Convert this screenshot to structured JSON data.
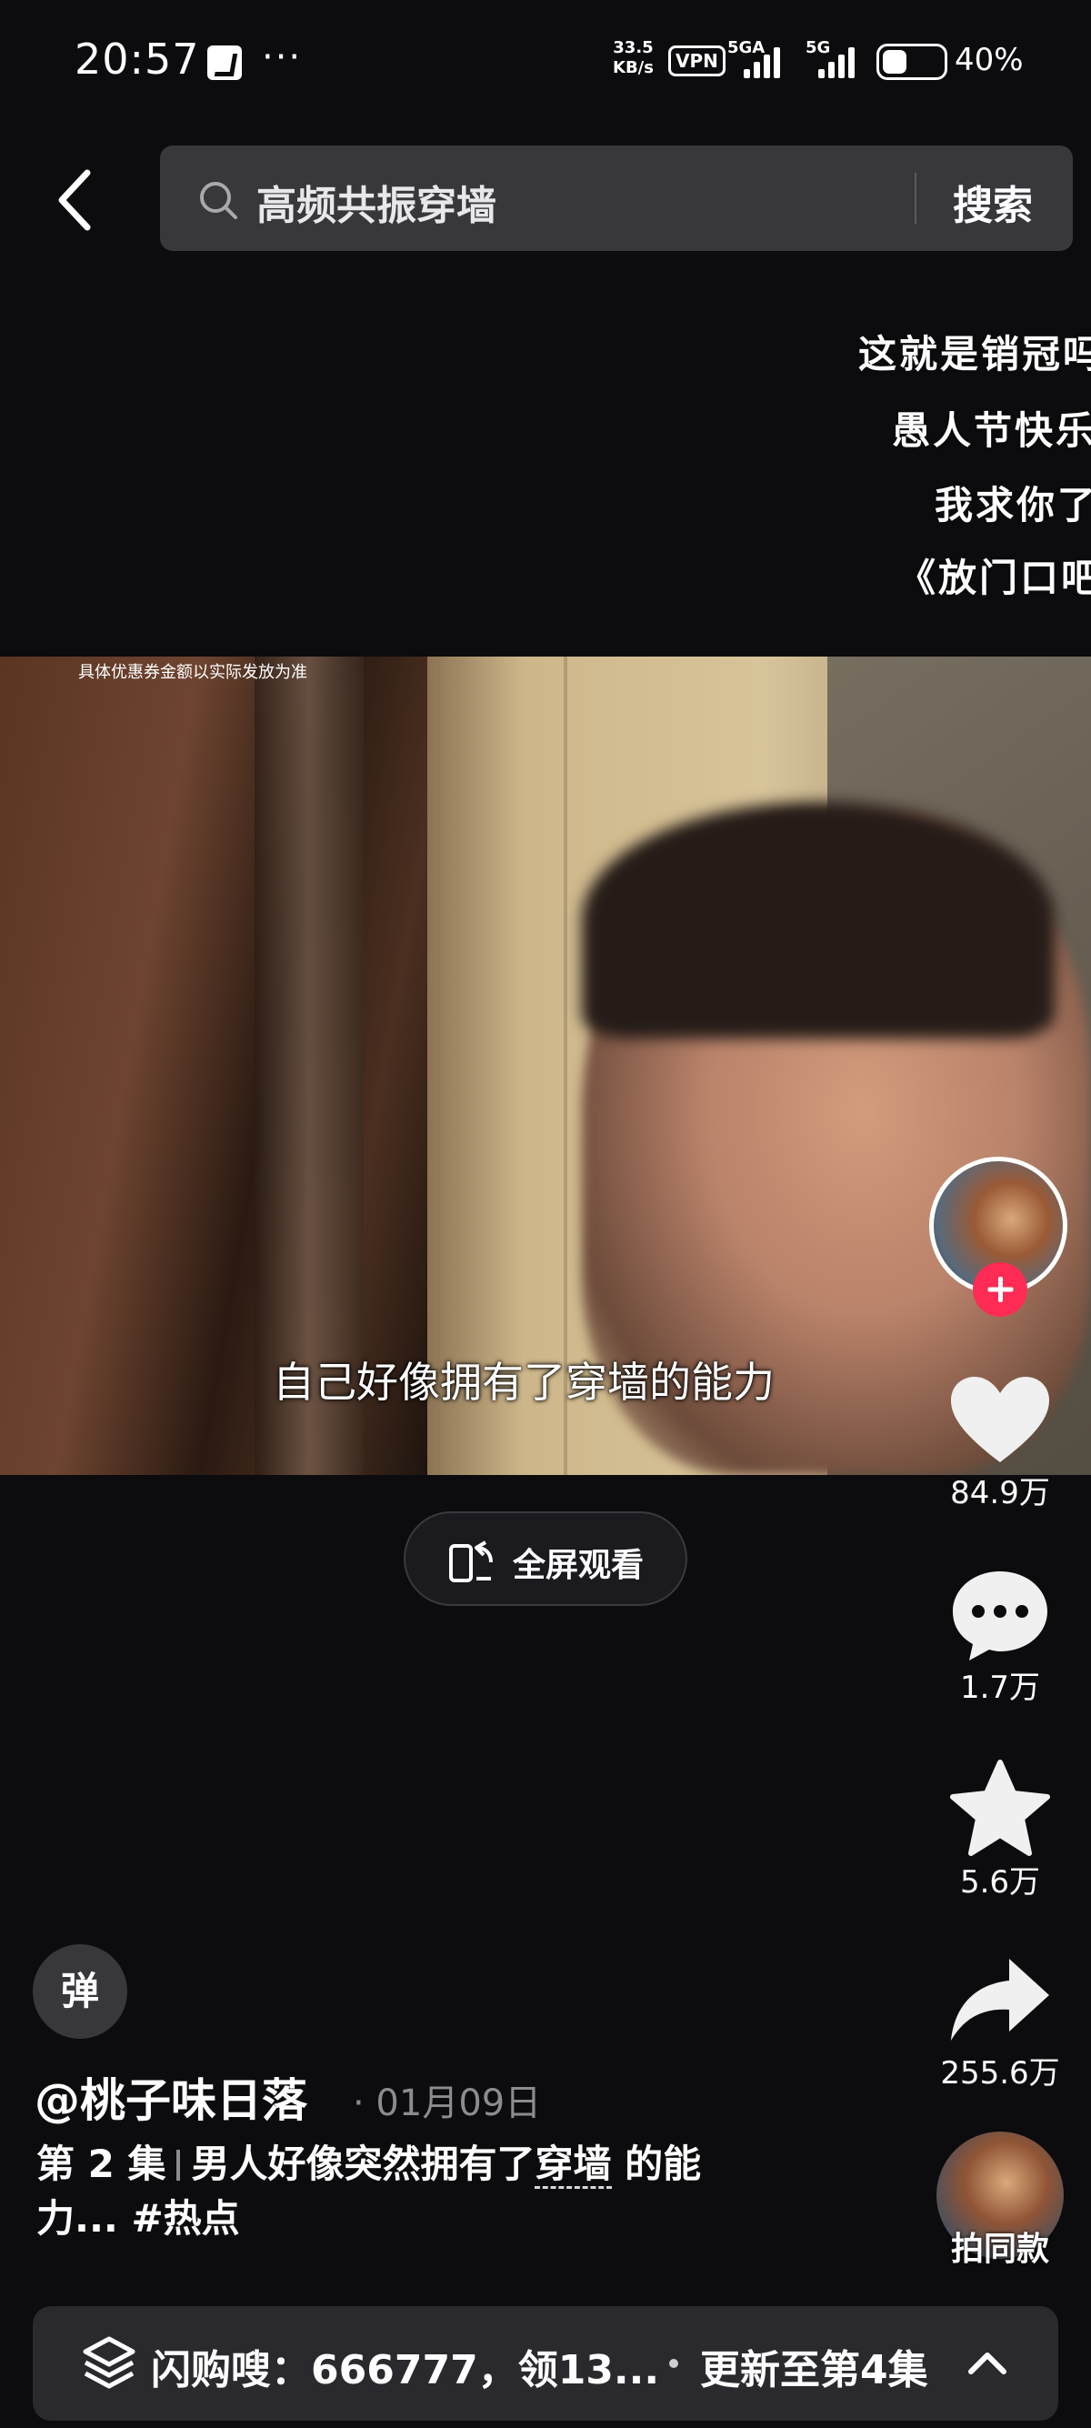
{
  "status_bar": {
    "time": "20:57",
    "more": "···",
    "net_speed_value": "33.5",
    "net_speed_unit": "KB/s",
    "vpn": "VPN",
    "sim1": "5GA",
    "sim2": "5G",
    "battery": "40%"
  },
  "search": {
    "query": "高频共振穿墙",
    "button": "搜索"
  },
  "danmaku": [
    "这就是销冠吗",
    "愚人节快乐",
    "我求你了",
    "《放门口吧"
  ],
  "video": {
    "note": "具体优惠券金额以实际发放为准",
    "subtitle": "自己好像拥有了穿墙的能力"
  },
  "fullscreen": {
    "label": "全屏观看"
  },
  "rail": {
    "likes": "84.9万",
    "comments": "1.7万",
    "favorites": "5.6万",
    "shares": "255.6万",
    "make_same": "拍同款"
  },
  "danmaku_toggle": "弹",
  "post": {
    "author": "@桃子味日落",
    "date": "· 01月09日",
    "episode": "第 2 集",
    "caption_pre": "男人好像突然拥有了",
    "keyword": "穿墙",
    "caption_post": " 的能力... #热点"
  },
  "bottom": {
    "promo": "闪购嗖：666777，领13...",
    "update": "更新至第4集"
  },
  "colors": {
    "background": "#0c0b0e",
    "follow_badge": "#fe2c55",
    "search_box": "#38373c"
  }
}
